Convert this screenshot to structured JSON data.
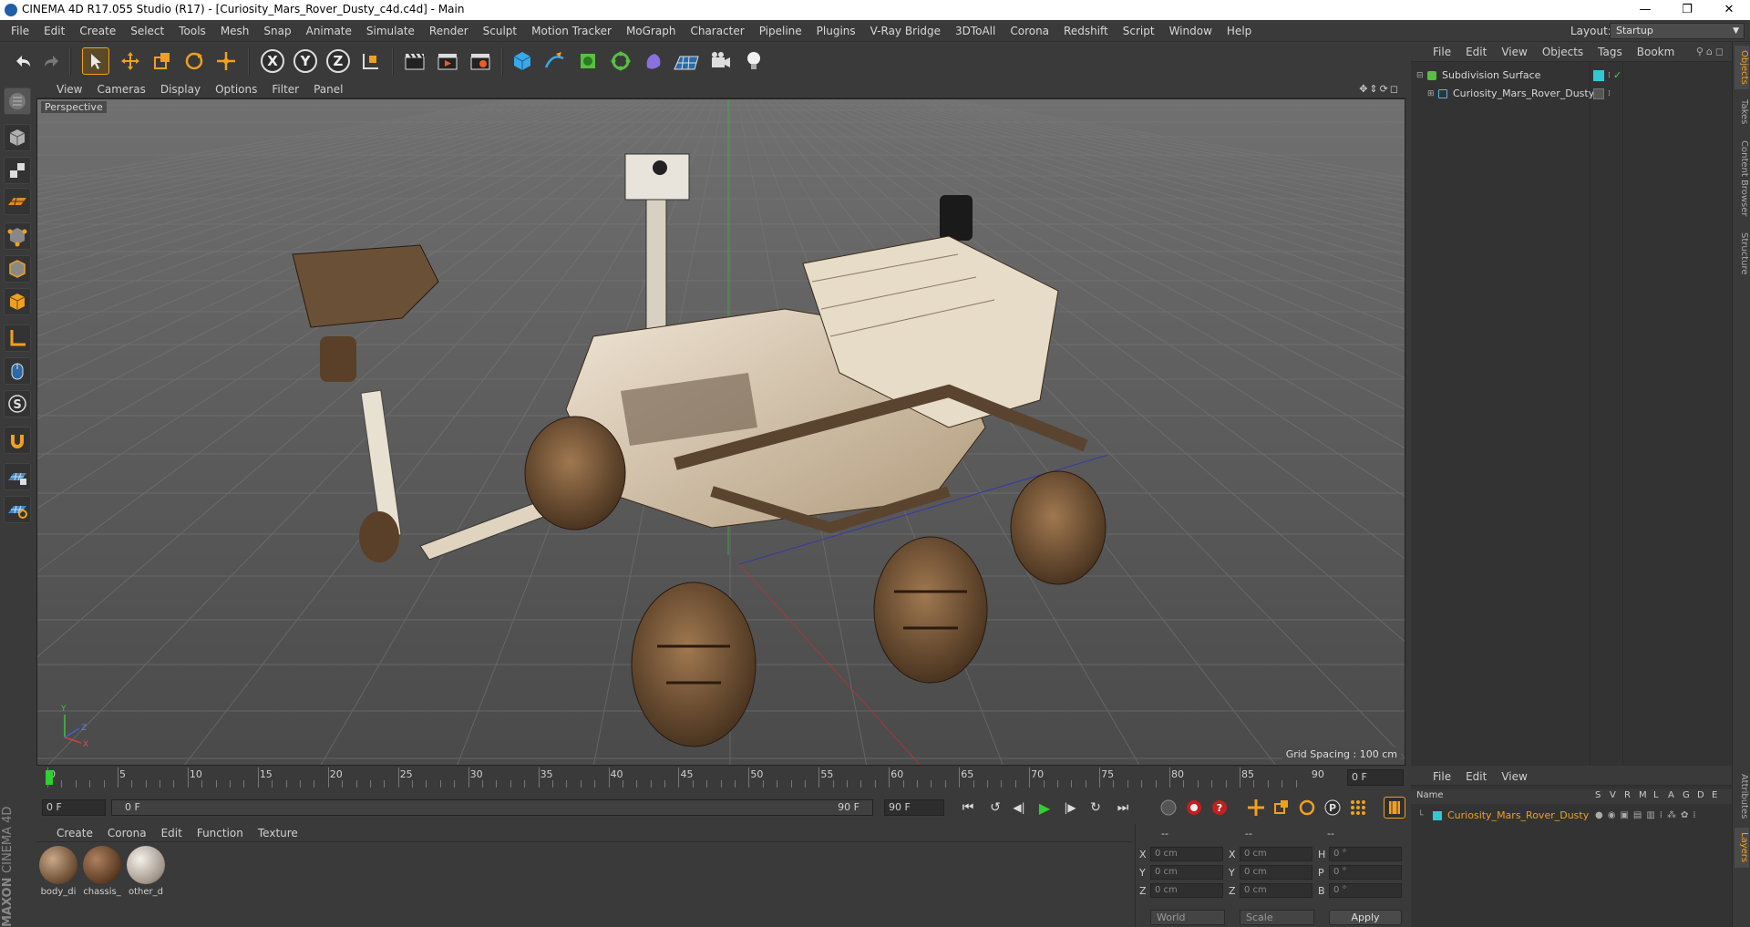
{
  "window": {
    "title": "CINEMA 4D R17.055 Studio (R17) - [Curiosity_Mars_Rover_Dusty_c4d.c4d] - Main",
    "controls": [
      "—",
      "❐",
      "✕"
    ]
  },
  "menubar": {
    "items": [
      "File",
      "Edit",
      "Create",
      "Select",
      "Tools",
      "Mesh",
      "Snap",
      "Animate",
      "Simulate",
      "Render",
      "Sculpt",
      "Motion Tracker",
      "MoGraph",
      "Character",
      "Pipeline",
      "Plugins",
      "V-Ray Bridge",
      "3DToAll",
      "Corona",
      "Redshift",
      "Script",
      "Window",
      "Help"
    ],
    "layout_label": "Layout:",
    "layout_value": "Startup"
  },
  "toolbar": {
    "axis_x": "X",
    "axis_y": "Y",
    "axis_z": "Z"
  },
  "viewport": {
    "menu": [
      "View",
      "Cameras",
      "Display",
      "Options",
      "Filter",
      "Panel"
    ],
    "label": "Perspective",
    "grid_spacing": "Grid Spacing : 100 cm",
    "axis_labels": {
      "y": "Y",
      "z": "Z",
      "x": "X"
    }
  },
  "timeline": {
    "ticks": [
      "0",
      "5",
      "10",
      "15",
      "20",
      "25",
      "30",
      "35",
      "40",
      "45",
      "50",
      "55",
      "60",
      "65",
      "70",
      "75",
      "80",
      "85",
      "90"
    ],
    "current_frame_field": "0 F",
    "start_field": "0 F",
    "range_start": "0 F",
    "range_end": "90 F",
    "end_field": "90 F"
  },
  "materials": {
    "menu": [
      "Create",
      "Corona",
      "Edit",
      "Function",
      "Texture"
    ],
    "items": [
      {
        "name": "body_di"
      },
      {
        "name": "chassis_"
      },
      {
        "name": "other_d"
      }
    ]
  },
  "coordinates": {
    "headers": [
      "--",
      "--",
      "--"
    ],
    "rows": [
      {
        "a": "X",
        "av": "0 cm",
        "b": "X",
        "bv": "0 cm",
        "c": "H",
        "cv": "0 °"
      },
      {
        "a": "Y",
        "av": "0 cm",
        "b": "Y",
        "bv": "0 cm",
        "c": "P",
        "cv": "0 °"
      },
      {
        "a": "Z",
        "av": "0 cm",
        "b": "Z",
        "bv": "0 cm",
        "c": "B",
        "cv": "0 °"
      }
    ],
    "world": "World",
    "scale": "Scale",
    "apply": "Apply"
  },
  "object_manager": {
    "menu": [
      "File",
      "Edit",
      "View",
      "Objects",
      "Tags",
      "Bookm"
    ],
    "objects": [
      {
        "name": "Subdivision Surface"
      },
      {
        "name": "Curiosity_Mars_Rover_Dusty"
      }
    ]
  },
  "layers_manager": {
    "menu": [
      "File",
      "Edit",
      "View"
    ],
    "name_header": "Name",
    "flag_headers": [
      "S",
      "V",
      "R",
      "M",
      "L",
      "A",
      "G",
      "D",
      "E"
    ],
    "layer_name": "Curiosity_Mars_Rover_Dusty"
  },
  "side_tabs": [
    "Objects",
    "Takes",
    "Content Browser",
    "Structure"
  ],
  "side_tabs_bottom": [
    "Attributes",
    "Layers"
  ],
  "brand": {
    "line1": "MAXON",
    "line2": "CINEMA 4D"
  },
  "colors": {
    "accent": "#f0a020",
    "selected_text": "#f0a020",
    "layer_swatch": "#30c8d8"
  }
}
